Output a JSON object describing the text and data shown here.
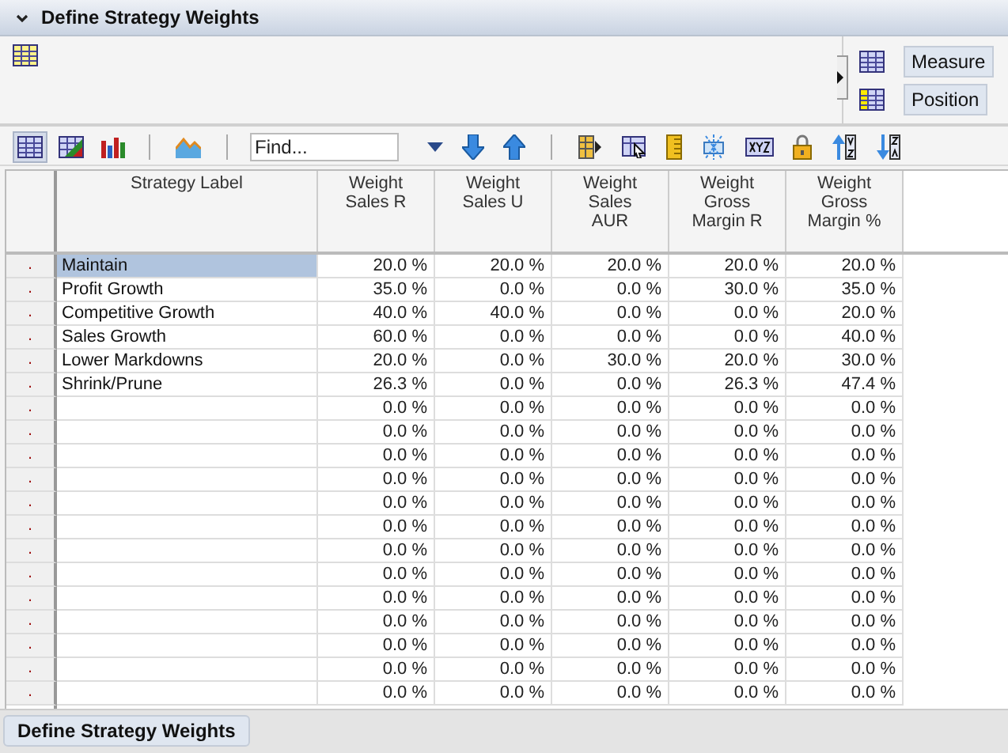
{
  "panel": {
    "title": "Define Strategy Weights",
    "expanded": true
  },
  "axes": [
    {
      "label": "Measure"
    },
    {
      "label": "Position"
    }
  ],
  "toolbar": {
    "views": [
      {
        "kind": "grid",
        "selected": true
      },
      {
        "kind": "mixed",
        "selected": false
      },
      {
        "kind": "bars",
        "selected": false
      }
    ],
    "find": {
      "placeholder": "Find..."
    }
  },
  "table": {
    "columns": [
      "Strategy Label",
      "Weight Sales R",
      "Weight Sales U",
      "Weight Sales AUR",
      "Weight Gross Margin R",
      "Weight Gross Margin %"
    ],
    "rows": [
      {
        "marker": ".",
        "label": "Maintain",
        "selected": true,
        "values": [
          "20.0 %",
          "20.0 %",
          "20.0 %",
          "20.0 %",
          "20.0 %"
        ]
      },
      {
        "marker": ".",
        "label": "Profit Growth",
        "selected": false,
        "values": [
          "35.0 %",
          "0.0 %",
          "0.0 %",
          "30.0 %",
          "35.0 %"
        ]
      },
      {
        "marker": ".",
        "label": "Competitive Growth",
        "selected": false,
        "values": [
          "40.0 %",
          "40.0 %",
          "0.0 %",
          "0.0 %",
          "20.0 %"
        ]
      },
      {
        "marker": ".",
        "label": "Sales Growth",
        "selected": false,
        "values": [
          "60.0 %",
          "0.0 %",
          "0.0 %",
          "0.0 %",
          "40.0 %"
        ]
      },
      {
        "marker": ".",
        "label": "Lower Markdowns",
        "selected": false,
        "values": [
          "20.0 %",
          "0.0 %",
          "30.0 %",
          "20.0 %",
          "30.0 %"
        ]
      },
      {
        "marker": ".",
        "label": "Shrink/Prune",
        "selected": false,
        "values": [
          "26.3 %",
          "0.0 %",
          "0.0 %",
          "26.3 %",
          "47.4 %"
        ]
      },
      {
        "marker": ".",
        "label": "",
        "selected": false,
        "values": [
          "0.0 %",
          "0.0 %",
          "0.0 %",
          "0.0 %",
          "0.0 %"
        ]
      },
      {
        "marker": ".",
        "label": "",
        "selected": false,
        "values": [
          "0.0 %",
          "0.0 %",
          "0.0 %",
          "0.0 %",
          "0.0 %"
        ]
      },
      {
        "marker": ".",
        "label": "",
        "selected": false,
        "values": [
          "0.0 %",
          "0.0 %",
          "0.0 %",
          "0.0 %",
          "0.0 %"
        ]
      },
      {
        "marker": ".",
        "label": "",
        "selected": false,
        "values": [
          "0.0 %",
          "0.0 %",
          "0.0 %",
          "0.0 %",
          "0.0 %"
        ]
      },
      {
        "marker": ".",
        "label": "",
        "selected": false,
        "values": [
          "0.0 %",
          "0.0 %",
          "0.0 %",
          "0.0 %",
          "0.0 %"
        ]
      },
      {
        "marker": ".",
        "label": "",
        "selected": false,
        "values": [
          "0.0 %",
          "0.0 %",
          "0.0 %",
          "0.0 %",
          "0.0 %"
        ]
      },
      {
        "marker": ".",
        "label": "",
        "selected": false,
        "values": [
          "0.0 %",
          "0.0 %",
          "0.0 %",
          "0.0 %",
          "0.0 %"
        ]
      },
      {
        "marker": ".",
        "label": "",
        "selected": false,
        "values": [
          "0.0 %",
          "0.0 %",
          "0.0 %",
          "0.0 %",
          "0.0 %"
        ]
      },
      {
        "marker": ".",
        "label": "",
        "selected": false,
        "values": [
          "0.0 %",
          "0.0 %",
          "0.0 %",
          "0.0 %",
          "0.0 %"
        ]
      },
      {
        "marker": ".",
        "label": "",
        "selected": false,
        "values": [
          "0.0 %",
          "0.0 %",
          "0.0 %",
          "0.0 %",
          "0.0 %"
        ]
      },
      {
        "marker": ".",
        "label": "",
        "selected": false,
        "values": [
          "0.0 %",
          "0.0 %",
          "0.0 %",
          "0.0 %",
          "0.0 %"
        ]
      },
      {
        "marker": ".",
        "label": "",
        "selected": false,
        "values": [
          "0.0 %",
          "0.0 %",
          "0.0 %",
          "0.0 %",
          "0.0 %"
        ]
      },
      {
        "marker": ".",
        "label": "",
        "selected": false,
        "values": [
          "0.0 %",
          "0.0 %",
          "0.0 %",
          "0.0 %",
          "0.0 %"
        ]
      }
    ]
  },
  "tabs": [
    {
      "label": "Define Strategy Weights",
      "selected": true
    }
  ]
}
